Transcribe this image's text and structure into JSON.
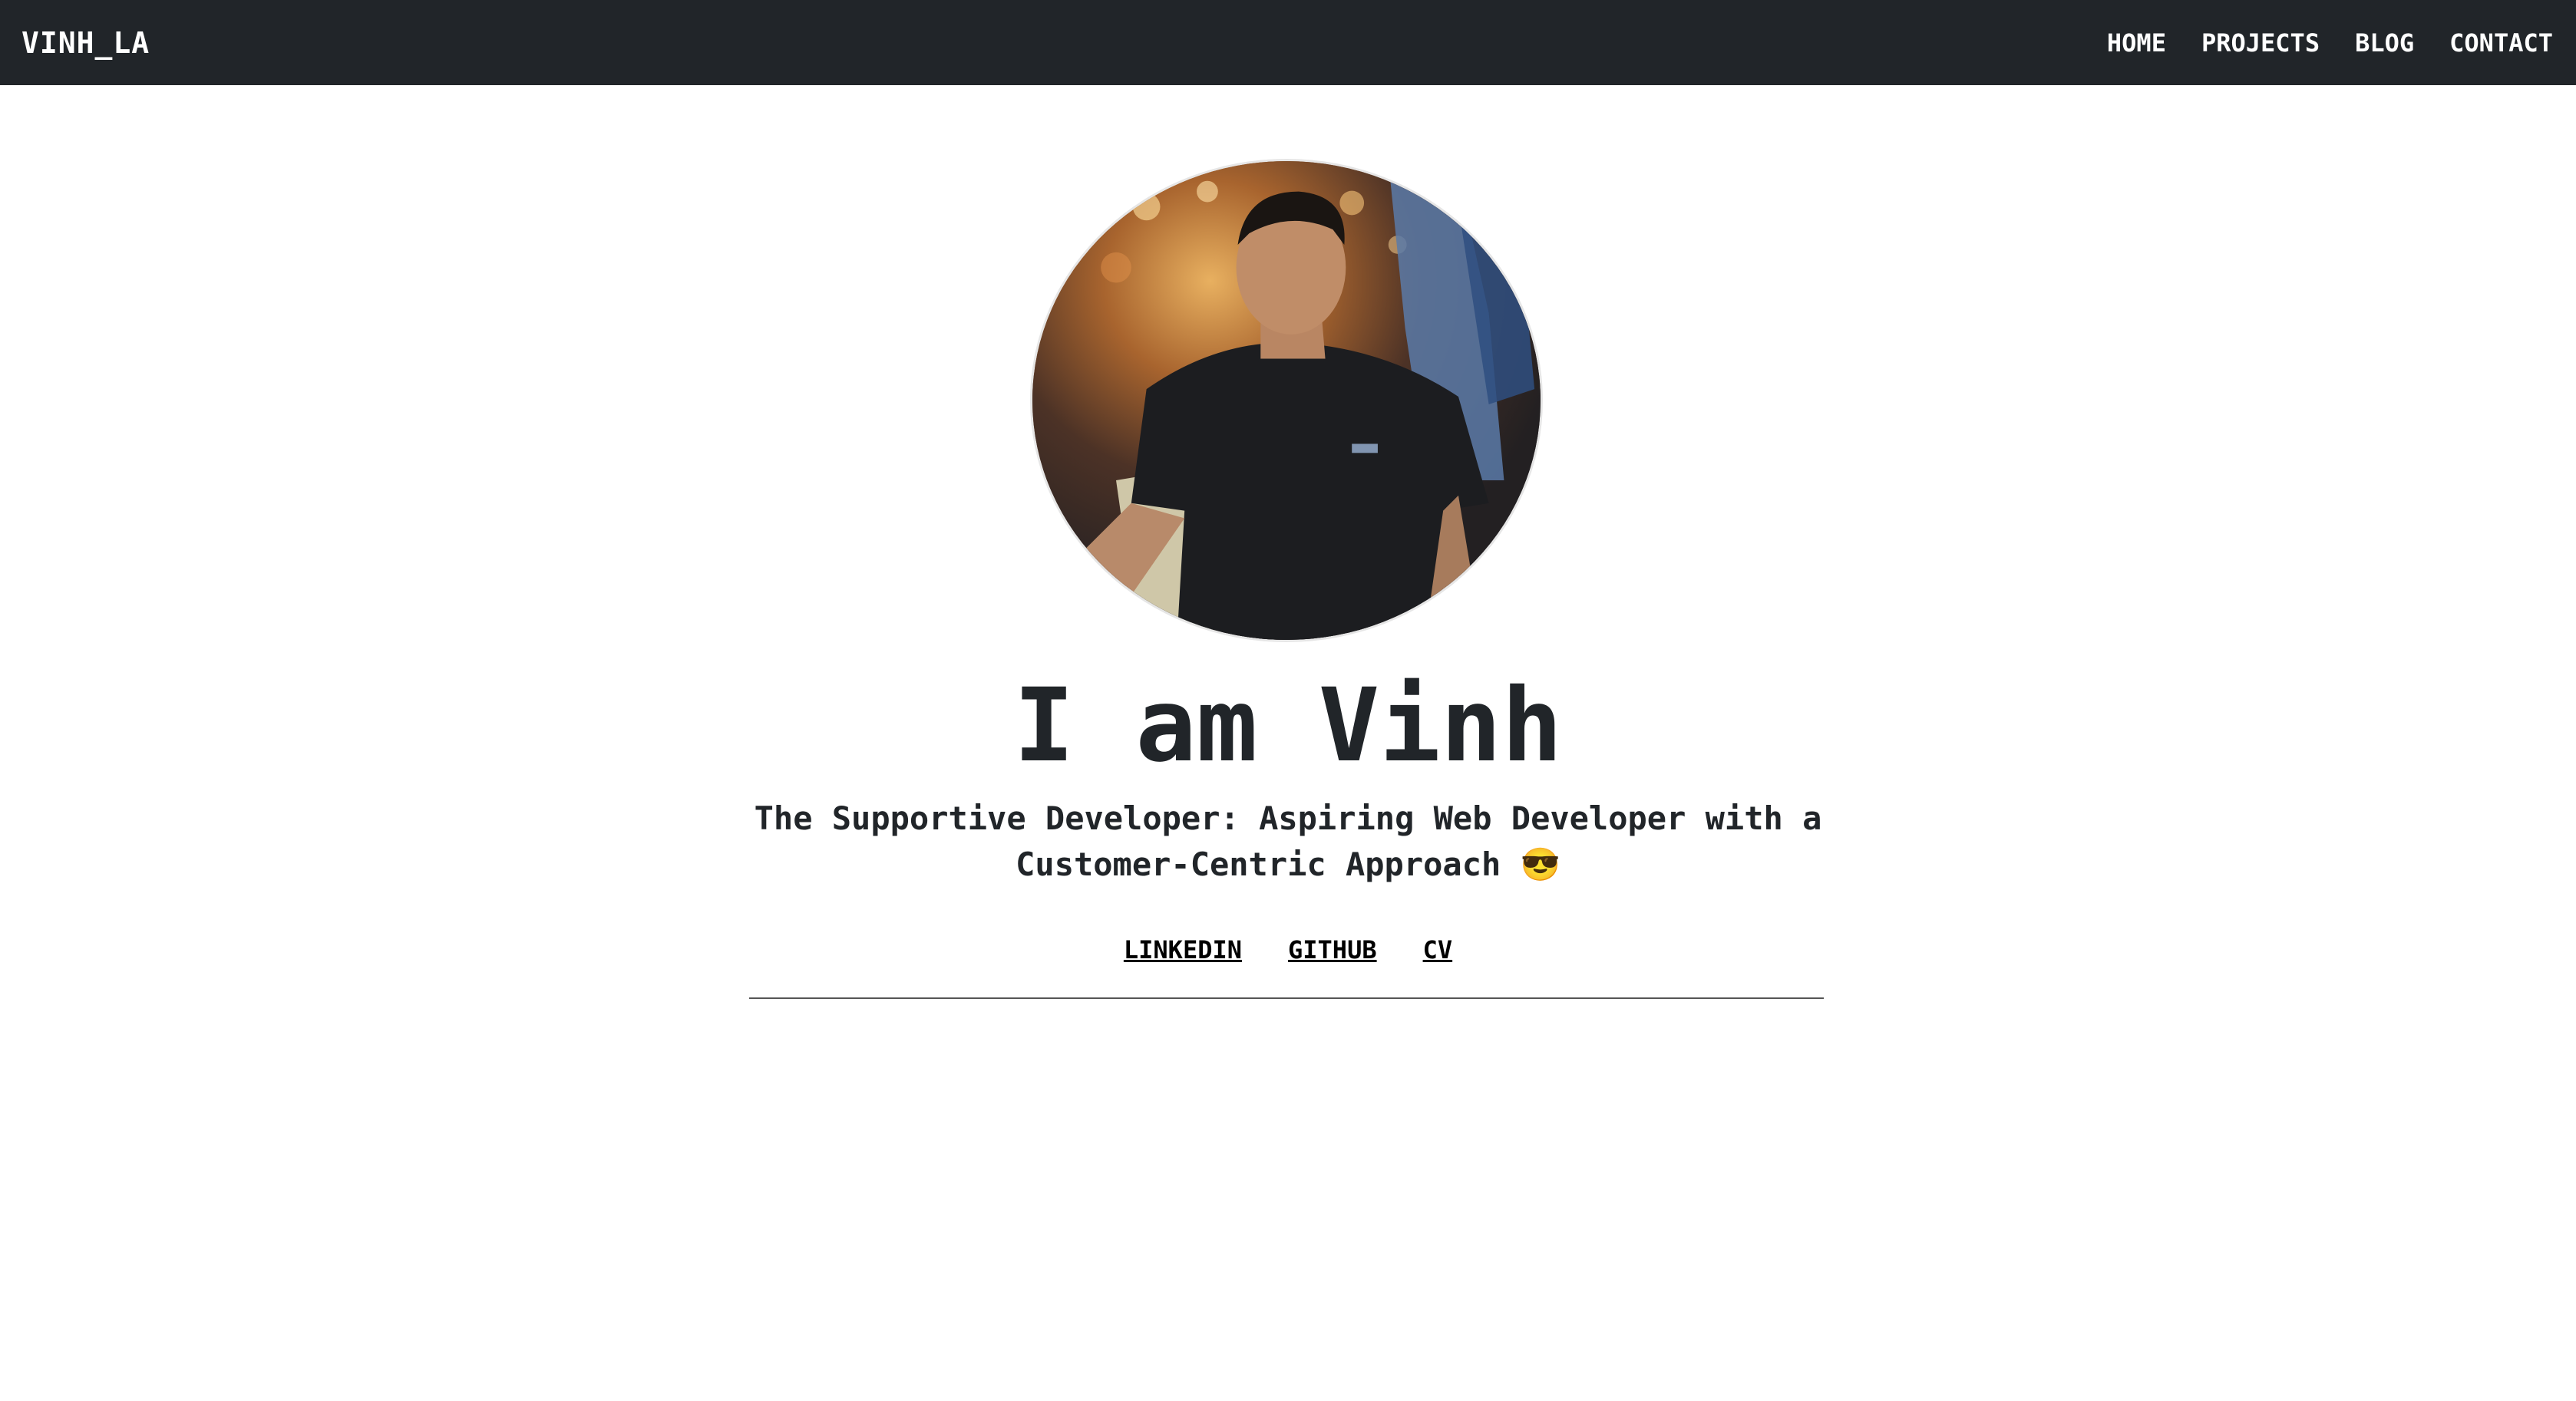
{
  "navbar": {
    "brand": "VINH_LA",
    "links": [
      {
        "label": "HOME"
      },
      {
        "label": "PROJECTS"
      },
      {
        "label": "BLOG"
      },
      {
        "label": "CONTACT"
      }
    ]
  },
  "hero": {
    "title": "I am Vinh",
    "subtitle_line1": "The Supportive Developer: Aspiring Web Developer with a",
    "subtitle_line2": "Customer-Centric Approach 😎",
    "links": [
      {
        "label": "LINKEDIN"
      },
      {
        "label": "GITHUB"
      },
      {
        "label": "CV"
      }
    ]
  },
  "colors": {
    "navbar_bg": "#212529",
    "text": "#212529",
    "background": "#ffffff"
  }
}
